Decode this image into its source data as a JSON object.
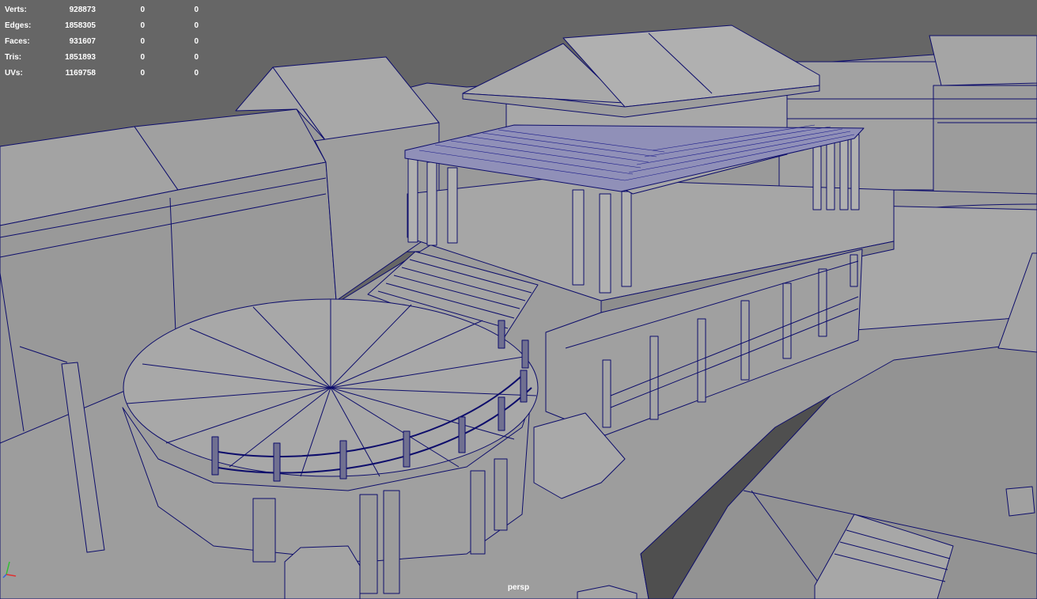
{
  "hud": {
    "rows": [
      {
        "label": "Verts:",
        "values": [
          "928873",
          "0",
          "0"
        ]
      },
      {
        "label": "Edges:",
        "values": [
          "1858305",
          "0",
          "0"
        ]
      },
      {
        "label": "Faces:",
        "values": [
          "931607",
          "0",
          "0"
        ]
      },
      {
        "label": "Tris:",
        "values": [
          "1851893",
          "0",
          "0"
        ]
      },
      {
        "label": "UVs:",
        "values": [
          "1169758",
          "0",
          "0"
        ]
      }
    ]
  },
  "viewport": {
    "camera_label": "persp",
    "background_color": "#666666",
    "mesh_fill_color": "#9a9a9a",
    "wireframe_color": "#0d0d6b"
  },
  "axis_gizmo": {
    "x_color": "#e03030",
    "y_color": "#30c030",
    "z_color": "#3060e0"
  }
}
